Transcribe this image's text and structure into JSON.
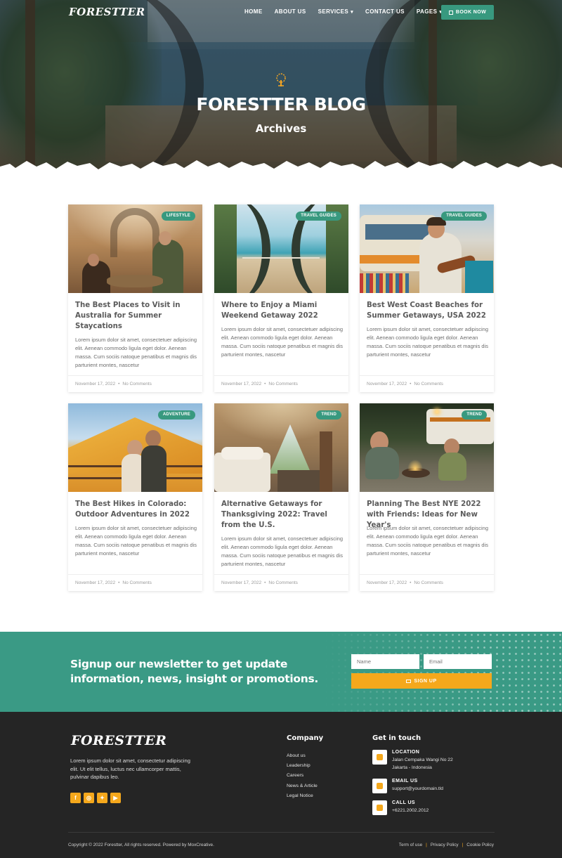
{
  "header": {
    "logo": "FORESTTER",
    "nav": [
      {
        "label": "HOME",
        "dropdown": false
      },
      {
        "label": "ABOUT US",
        "dropdown": false
      },
      {
        "label": "SERVICES",
        "dropdown": true
      },
      {
        "label": "CONTACT US",
        "dropdown": false
      },
      {
        "label": "PAGES",
        "dropdown": true
      }
    ],
    "book_button": "BOOK NOW"
  },
  "hero": {
    "title": "FORESTTER BLOG",
    "subtitle": "Archives"
  },
  "posts": [
    {
      "badge": "LIFESTYLE",
      "title": "The Best Places to Visit in Australia for Summer Staycations",
      "excerpt": "Lorem ipsum dolor sit amet, consectetuer adipiscing elit. Aenean commodo ligula eget dolor. Aenean massa. Cum sociis natoque penatibus et magnis dis parturient montes, nascetur",
      "date": "November 17, 2022",
      "comments": "No Comments"
    },
    {
      "badge": "TRAVEL GUIDES",
      "title": "Where to Enjoy a Miami Weekend Getaway 2022",
      "excerpt": "Lorem ipsum dolor sit amet, consectetuer adipiscing elit. Aenean commodo ligula eget dolor. Aenean massa. Cum sociis natoque penatibus et magnis dis parturient montes, nascetur",
      "date": "November 17, 2022",
      "comments": "No Comments"
    },
    {
      "badge": "TRAVEL GUIDES",
      "title": "Best West Coast Beaches for Summer Getaways, USA 2022",
      "excerpt": "Lorem ipsum dolor sit amet, consectetuer adipiscing elit. Aenean commodo ligula eget dolor. Aenean massa. Cum sociis natoque penatibus et magnis dis parturient montes, nascetur",
      "date": "November 17, 2022",
      "comments": "No Comments"
    },
    {
      "badge": "ADVENTURE",
      "title": "The Best Hikes in Colorado: Outdoor Adventures in 2022",
      "excerpt": "Lorem ipsum dolor sit amet, consectetuer adipiscing elit. Aenean commodo ligula eget dolor. Aenean massa. Cum sociis natoque penatibus et magnis dis parturient montes, nascetur",
      "date": "November 17, 2022",
      "comments": "No Comments"
    },
    {
      "badge": "TREND",
      "title": "Alternative Getaways for Thanksgiving 2022: Travel from the U.S.",
      "excerpt": "Lorem ipsum dolor sit amet, consectetuer adipiscing elit. Aenean commodo ligula eget dolor. Aenean massa. Cum sociis natoque penatibus et magnis dis parturient montes, nascetur",
      "date": "November 17, 2022",
      "comments": "No Comments"
    },
    {
      "badge": "TREND",
      "title": "Planning The Best NYE 2022 with Friends: Ideas for New Year's",
      "excerpt": "Lorem ipsum dolor sit amet, consectetuer adipiscing elit. Aenean commodo ligula eget dolor. Aenean massa. Cum sociis natoque penatibus et magnis dis parturient montes, nascetur",
      "date": "November 17, 2022",
      "comments": "No Comments"
    }
  ],
  "newsletter": {
    "text": "Signup our newsletter to get update information, news, insight or promotions.",
    "name_placeholder": "Name",
    "email_placeholder": "Email",
    "button": "SIGN UP"
  },
  "footer": {
    "logo": "FORESTTER",
    "description": "Lorem ipsum dolor sit amet, consectetur adipiscing elit. Ut elit tellus, luctus nec ullamcorper mattis, pulvinar dapibus leo.",
    "socials": [
      "facebook-icon",
      "instagram-icon",
      "twitter-icon",
      "youtube-icon"
    ],
    "company_heading": "Company",
    "company_links": [
      "About us",
      "Leadership",
      "Careers",
      "News & Article",
      "Legal Notice"
    ],
    "contact_heading": "Get in touch",
    "location_label": "LOCATION",
    "location_line1": "Jalan Cempaka Wangi No 22",
    "location_line2": "Jakarta - Indonesia",
    "email_label": "EMAIL US",
    "email_value": "support@yourdomain.tld",
    "call_label": "CALL US",
    "call_value": "+6221.2002.2012",
    "copyright": "Copyright © 2022 Forestter, All rights reserved. Powered by MoxCreative.",
    "legal_links": [
      "Term of use",
      "Privacy Policy",
      "Cookie Policy"
    ]
  },
  "colors": {
    "accent_green": "#38997f",
    "accent_orange": "#f5a81c",
    "footer_bg": "#252525"
  }
}
